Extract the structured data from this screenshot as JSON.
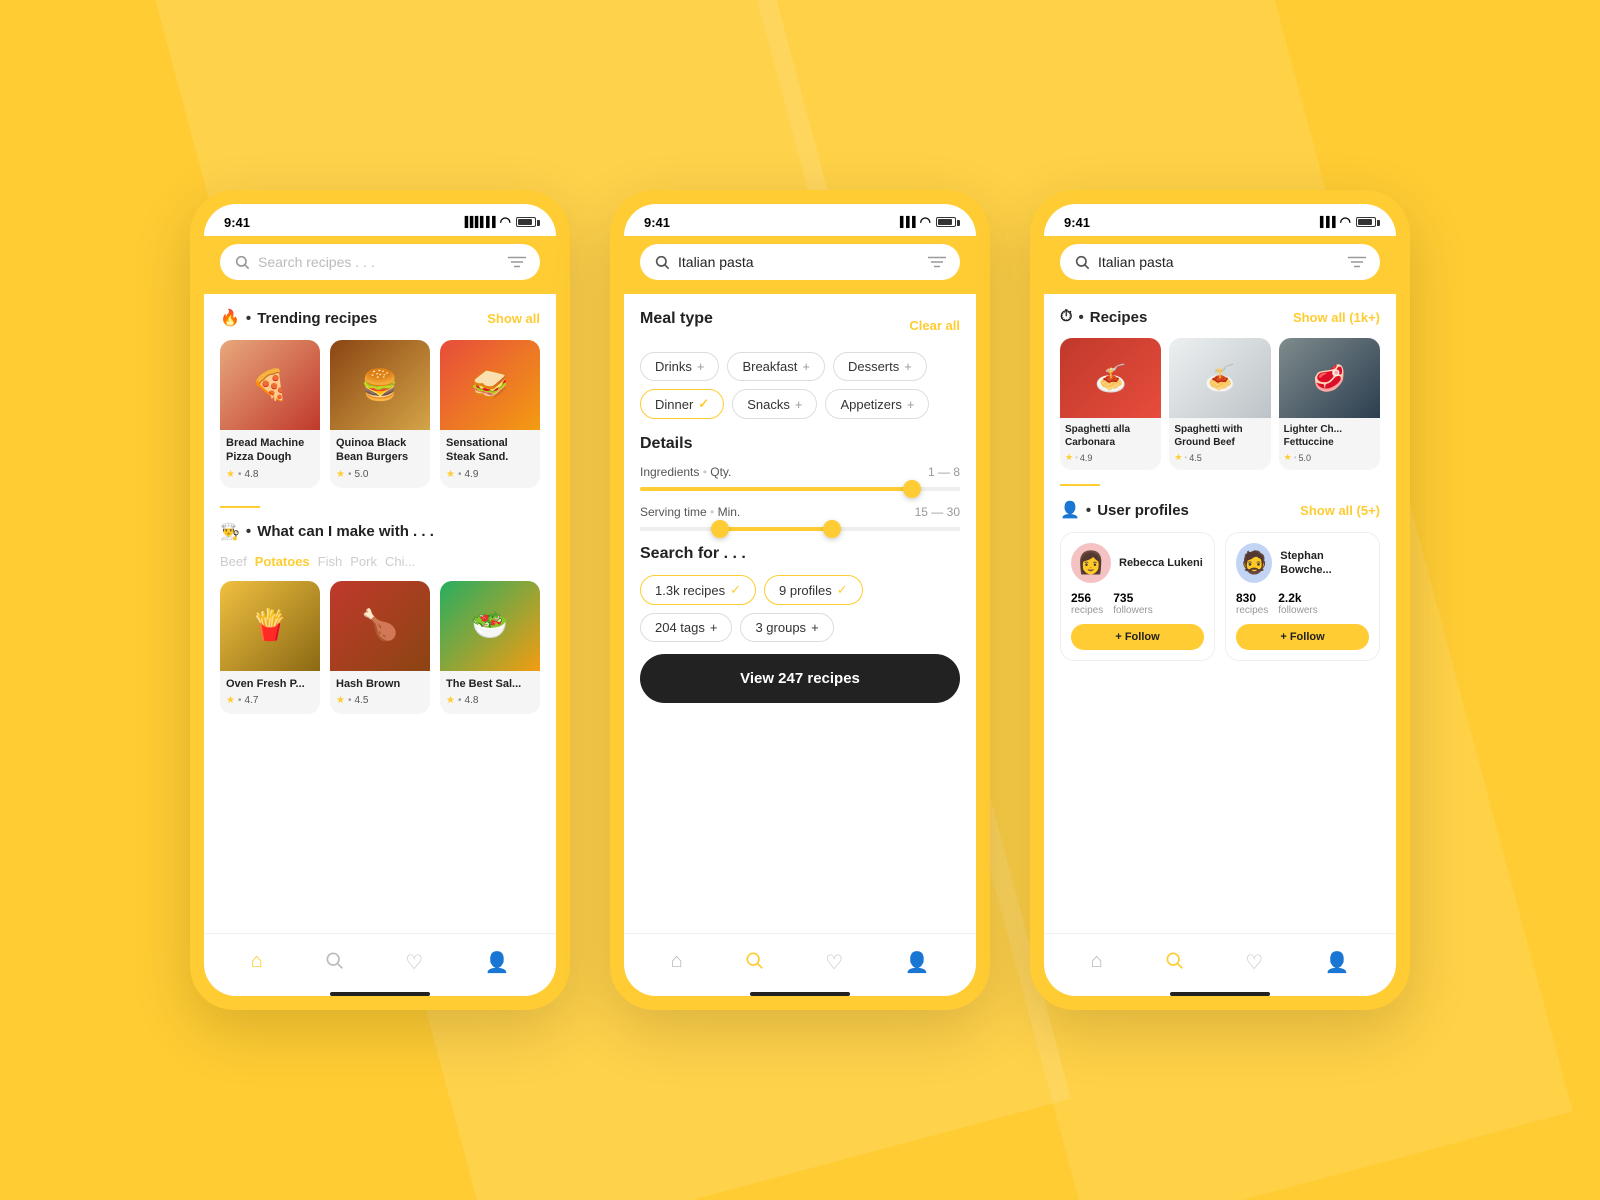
{
  "bg_color": "#FFCC33",
  "phones": [
    {
      "id": "phone1",
      "status_time": "9:41",
      "header": {
        "search_placeholder": "Search recipes . . ."
      },
      "sections": {
        "trending": {
          "label": "Trending recipes",
          "show_all": "Show all",
          "recipes": [
            {
              "name": "Bread Machine Pizza Dough",
              "rating": "4.8",
              "img_class": "food-pizza"
            },
            {
              "name": "Quinoa Black Bean Burgers",
              "rating": "5.0",
              "img_class": "food-burger"
            },
            {
              "name": "Sensational Steak Sand.",
              "rating": "4.9",
              "img_class": "food-sandwich"
            }
          ]
        },
        "ingredients": {
          "label": "What can I make with . . .",
          "tags": [
            "Beef",
            "Potatoes",
            "Fish",
            "Pork",
            "Chi..."
          ],
          "active_tag": "Potatoes",
          "recipes": [
            {
              "name": "Oven Fresh P...",
              "rating": "4.7",
              "img_class": "food-fries"
            },
            {
              "name": "Hash Brown",
              "rating": "4.5",
              "img_class": "food-chicken"
            },
            {
              "name": "The Best Sal...",
              "rating": "4.8",
              "img_class": "food-salad"
            }
          ]
        }
      },
      "nav": [
        "home",
        "search",
        "heart",
        "user"
      ]
    },
    {
      "id": "phone2",
      "status_time": "9:41",
      "header": {
        "search_value": "Italian pasta"
      },
      "filter": {
        "meal_type_label": "Meal type",
        "clear_all": "Clear all",
        "meal_types": [
          {
            "name": "Drinks",
            "selected": false
          },
          {
            "name": "Breakfast",
            "selected": false
          },
          {
            "name": "Desserts",
            "selected": false
          },
          {
            "name": "Dinner",
            "selected": true
          },
          {
            "name": "Snacks",
            "selected": false
          },
          {
            "name": "Appetizers",
            "selected": false
          }
        ],
        "details_label": "Details",
        "ingredients_label": "Ingredients",
        "ingredients_qty_label": "Qty.",
        "ingredients_range": "1 — 8",
        "serving_label": "Serving time",
        "serving_unit": "Min.",
        "serving_range": "15 — 30",
        "search_for_label": "Search for . . .",
        "search_options": [
          {
            "name": "1.3k recipes",
            "selected": true
          },
          {
            "name": "9 profiles",
            "selected": true
          },
          {
            "name": "204 tags",
            "selected": false
          },
          {
            "name": "3 groups",
            "selected": false
          }
        ],
        "view_btn": "View 247 recipes"
      },
      "nav": [
        "home",
        "search",
        "heart",
        "user"
      ]
    },
    {
      "id": "phone3",
      "status_time": "9:41",
      "header": {
        "search_value": "Italian pasta"
      },
      "recipes_section": {
        "label": "Recipes",
        "show_all": "Show all (1k+)",
        "recipes": [
          {
            "name": "Spaghetti alla Carbonara",
            "rating": "4.9",
            "img_class": "food-pasta-red"
          },
          {
            "name": "Spaghetti with Ground Beef",
            "rating": "4.5",
            "img_class": "food-pasta-white"
          },
          {
            "name": "Lighter Ch... Fettuccine",
            "rating": "5.0",
            "img_class": "food-grill"
          }
        ]
      },
      "profiles_section": {
        "label": "User profiles",
        "show_all": "Show all (5+)",
        "profiles": [
          {
            "name": "Rebecca Lukeni",
            "recipes": "256",
            "followers": "735",
            "avatar_emoji": "👩",
            "avatar_bg": "#f4c2c2"
          },
          {
            "name": "Stephan Bowche...",
            "recipes": "830",
            "followers": "2.2k",
            "avatar_emoji": "🧔",
            "avatar_bg": "#c2d4f4"
          }
        ],
        "follow_btn": "+ Follow",
        "recipes_label": "recipes",
        "followers_label": "followers"
      },
      "nav": [
        "home",
        "search",
        "heart",
        "user"
      ]
    }
  ]
}
